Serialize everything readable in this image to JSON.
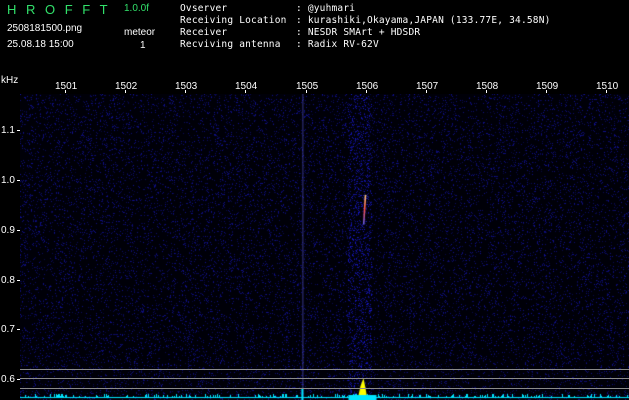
{
  "header": {
    "app_title": "H R O F F T",
    "version": "1.0.0f",
    "filename": "2508181500.png",
    "datetime": "25.08.18 15:00",
    "meteor_label": "meteor",
    "meteor_count": "1"
  },
  "info": {
    "observer_label": "Ovserver",
    "observer_value": ": @yuhmari",
    "location_label": "Receiving Location",
    "location_value": ": kurashiki,Okayama,JAPAN (133.77E, 34.58N)",
    "receiver_label": "Receiver",
    "receiver_value": ": NESDR SMArt + HDSDR",
    "antenna_label": "Recviving antenna",
    "antenna_value": ": Radix RV-62V"
  },
  "chart_data": {
    "type": "heatmap",
    "ylabel": "kHz",
    "x_ticks": [
      "1501",
      "1502",
      "1503",
      "1504",
      "1505",
      "1506",
      "1507",
      "1508",
      "1509",
      "1510"
    ],
    "y_ticks": [
      "1.1",
      "1.0",
      "0.9",
      "0.8",
      "0.7",
      "0.6"
    ],
    "y_range_khz": [
      0.58,
      1.18
    ],
    "meteor_echo": {
      "start_x": 1505.97,
      "end_x": 1506.0,
      "start_khz": 0.91,
      "end_khz": 0.97
    },
    "colors": {
      "background": "#000000",
      "noise": "#2a2ad0",
      "echo": "#ff5040",
      "spectrum": "#ffff00",
      "baseline": "#00e5ff"
    }
  }
}
